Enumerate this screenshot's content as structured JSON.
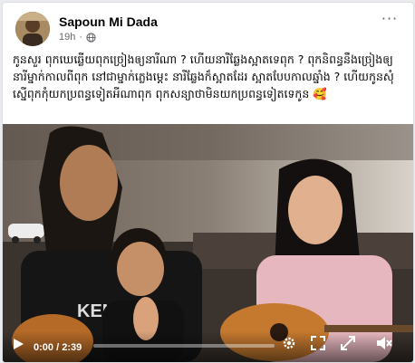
{
  "post": {
    "author": "Sapoun Mi Dada",
    "timestamp": "19h",
    "separator": "·",
    "more_label": "···",
    "caption": "កូនសួរ ពុកឃេឆ្លើយពុកច្រៀងឲ្យនារីណា ? ហើយនារីឆ្លែងស្អាតទេពុក ? ពុកនិពន្ធនឹងច្រៀងឲ្យនារីម្នាក់កាលពីពុក នៅជាម្នាក់ភ្លេងម្ដេះ នារីឆ្លែងក៏ស្អាតដែរ ស្អាតបែបកាលឆ្នាំង ? ហើយកូនសុំស្នើពុកកុំយកប្រពន្ធទៀតអីណាពុក ពុកសន្យាថាមិនយកប្រពន្ធទៀតទេកូន 🥰"
  },
  "video": {
    "current_time": "0:00",
    "total_time": "2:39",
    "time_separator": "/",
    "progress": 0.0,
    "shirt_text": "KEN"
  },
  "colors": {
    "text_primary": "#050505",
    "text_secondary": "#65676b",
    "card_border": "#dddfe2"
  },
  "icons": [
    "globe-icon",
    "more-options-icon",
    "play-icon",
    "settings-icon",
    "fullscreen-icon",
    "volume-icon"
  ]
}
